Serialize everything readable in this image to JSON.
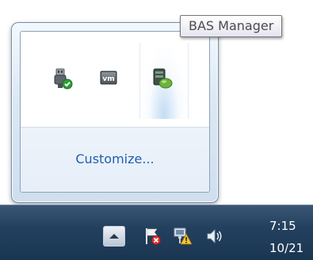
{
  "tooltip": {
    "text": "BAS Manager"
  },
  "flyout": {
    "icons": [
      {
        "name": "safely-remove-hardware-icon",
        "state": "ok"
      },
      {
        "name": "vmware-tools-icon",
        "label": "vm"
      },
      {
        "name": "bas-manager-icon",
        "selected": true
      }
    ],
    "customize_label": "Customize..."
  },
  "taskbar": {
    "overflow_button_icon": "chevron-up-icon",
    "tray_icons": [
      "action-center-flag-icon",
      "network-warning-icon",
      "volume-speaker-icon"
    ],
    "clock": {
      "time": "7:15",
      "date": "10/21"
    }
  },
  "colors": {
    "link": "#1e5fb0",
    "taskbar": "#23415f",
    "tooltip_text": "#4c4c4c"
  }
}
